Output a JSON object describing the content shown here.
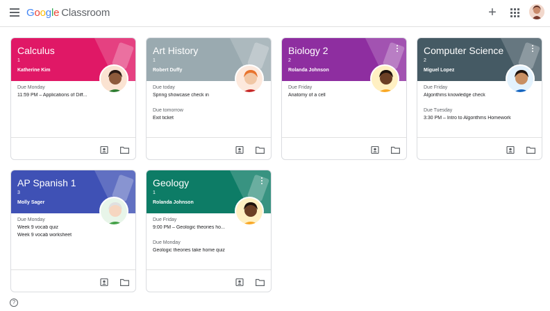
{
  "app": {
    "brand_letters": [
      "G",
      "o",
      "o",
      "g",
      "l",
      "e"
    ],
    "product": "Classroom"
  },
  "topbar": {
    "menu_icon": "menu-icon",
    "add_icon": "plus-icon",
    "apps_icon": "apps-grid-icon",
    "account_icon": "account-avatar"
  },
  "cards": [
    {
      "title": "Calculus",
      "section": "1",
      "teacher": "Katherine Kim",
      "color": "#e01866",
      "has_more": false,
      "work": [
        {
          "label": "Due Monday",
          "items": [
            "11:59 PM – Applications of Diff..."
          ]
        }
      ]
    },
    {
      "title": "Art History",
      "section": "1",
      "teacher": "Robert Duffy",
      "color": "#9aaab0",
      "has_more": false,
      "work": [
        {
          "label": "Due today",
          "items": [
            "Spring showcase check in"
          ]
        },
        {
          "label": "Due tomorrow",
          "items": [
            "Exit ticket"
          ]
        }
      ]
    },
    {
      "title": "Biology 2",
      "section": "2",
      "teacher": "Rolanda Johnson",
      "color": "#8e2ea0",
      "has_more": true,
      "work": [
        {
          "label": "Due Friday",
          "items": [
            "Anatomy of a cell"
          ]
        }
      ]
    },
    {
      "title": "Computer Science",
      "section": "2",
      "teacher": "Miguel Lopez",
      "color": "#455a64",
      "has_more": true,
      "work": [
        {
          "label": "Due Friday",
          "items": [
            "Algorithms knowledge check"
          ]
        },
        {
          "label": "Due Tuesday",
          "items": [
            "3:30 PM – Intro to Algorithms Homework"
          ]
        }
      ]
    },
    {
      "title": "AP Spanish 1",
      "section": "3",
      "teacher": "Molly Sager",
      "color": "#3f51b5",
      "has_more": false,
      "work": [
        {
          "label": "Due Monday",
          "items": [
            "Week 9 vocab quiz",
            "Week 9 vocab worksheet"
          ]
        }
      ]
    },
    {
      "title": "Geology",
      "section": "1",
      "teacher": "Rolanda Johnson",
      "color": "#0d7c66",
      "has_more": true,
      "work": [
        {
          "label": "Due Friday",
          "items": [
            "9:00 PM – Geologic theories ho..."
          ]
        },
        {
          "label": "Due Monday",
          "items": [
            "Geologic theories take home quiz"
          ]
        }
      ]
    }
  ],
  "footer_icons": [
    "assignment-person-icon",
    "folder-icon"
  ],
  "help_icon": "help-circle-icon",
  "help_glyph": "?"
}
